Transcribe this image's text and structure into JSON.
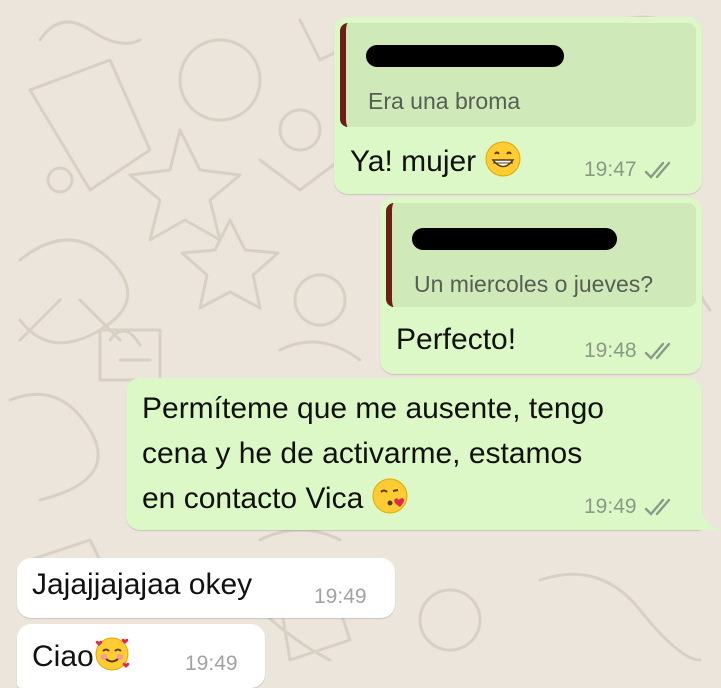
{
  "chat": {
    "messages": [
      {
        "direction": "outgoing",
        "quote_text": "Era una broma",
        "text": "Ya! mujer",
        "emoji": "grinning-face",
        "time": "19:47",
        "status": "read"
      },
      {
        "direction": "outgoing",
        "quote_text": "Un miercoles o jueves?",
        "text": "Perfecto!",
        "time": "19:48",
        "status": "read"
      },
      {
        "direction": "outgoing",
        "text_lines": [
          "Permíteme que me ausente, tengo",
          "cena y he de activarme, estamos",
          "en contacto Vica"
        ],
        "emoji": "face-blowing-kiss",
        "time": "19:49",
        "status": "read"
      },
      {
        "direction": "incoming",
        "text": "Jajajjajajaa okey",
        "time": "19:49"
      },
      {
        "direction": "incoming",
        "text": "Ciao",
        "emoji": "smiling-face-with-hearts",
        "time": "19:49"
      }
    ]
  },
  "colors": {
    "background": "#ece5dc",
    "outgoing_bubble": "#dcf8c6",
    "incoming_bubble": "#ffffff",
    "quote_bar": "#6b1f16",
    "read_tick": "#8b9a86"
  }
}
